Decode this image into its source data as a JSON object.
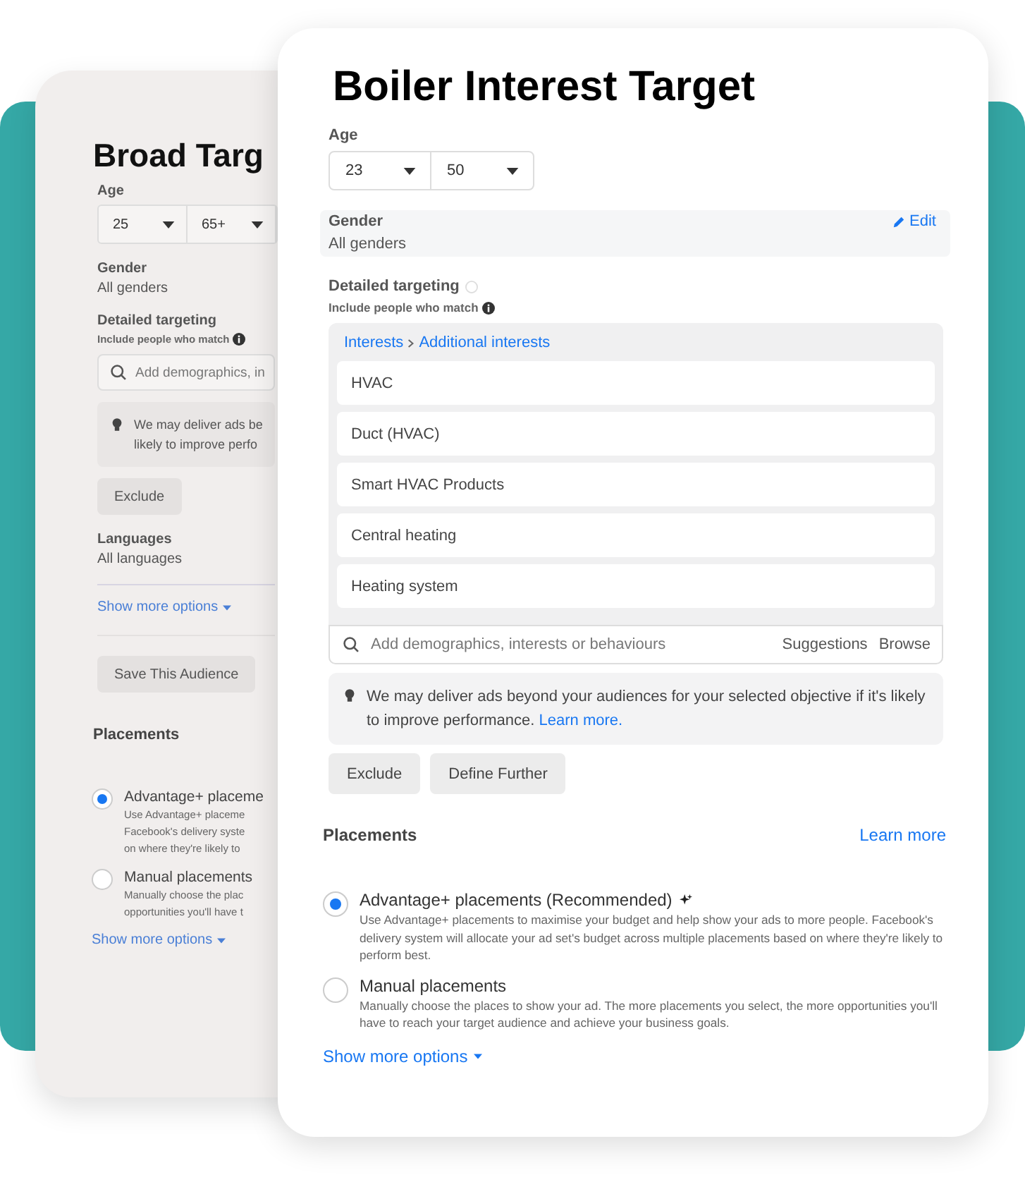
{
  "back_card": {
    "title": "Broad Targ",
    "age": {
      "label": "Age",
      "min": "25",
      "max": "65+"
    },
    "gender": {
      "label": "Gender",
      "value": "All genders"
    },
    "detailed_targeting": {
      "label": "Detailed targeting",
      "hint": "Include people who match",
      "search": {
        "placeholder": "Add demographics, in"
      },
      "note_lines": [
        "We may deliver ads be",
        "likely to improve perfo"
      ],
      "buttons": [
        "Exclude"
      ]
    },
    "languages": {
      "label": "Languages",
      "value": "All languages"
    },
    "show_more": "Show more options",
    "save_button": "Save This Audience",
    "placements": {
      "title": "Placements",
      "options": [
        {
          "label": "Advantage+ placeme",
          "selected": true,
          "description_lines": [
            "Use Advantage+ placeme",
            "Facebook's delivery syste",
            "on where they're likely to"
          ]
        },
        {
          "label": "Manual placements",
          "selected": false,
          "description_lines": [
            "Manually choose the plac",
            "opportunities you'll have t"
          ]
        }
      ],
      "show_more": "Show more options"
    }
  },
  "front_card": {
    "title": "Boiler Interest Target",
    "age": {
      "label": "Age",
      "min": "23",
      "max": "50"
    },
    "gender": {
      "label": "Gender",
      "value": "All genders",
      "edit": "Edit"
    },
    "detailed_targeting": {
      "label": "Detailed targeting",
      "hint": "Include people who match",
      "breadcrumb": [
        "Interests",
        "Additional interests"
      ],
      "interests": [
        "HVAC",
        "Duct (HVAC)",
        "Smart HVAC Products",
        "Central heating",
        "Heating system"
      ],
      "search": {
        "placeholder": "Add demographics, interests or behaviours",
        "actions": [
          "Suggestions",
          "Browse"
        ]
      },
      "note": {
        "text": "We may deliver ads beyond your audiences for your selected objective if it's likely to improve performance.",
        "link": "Learn more."
      },
      "buttons": [
        "Exclude",
        "Define Further"
      ]
    },
    "placements": {
      "title": "Placements",
      "link": "Learn more",
      "options": [
        {
          "label": "Advantage+ placements (Recommended)",
          "recommended": true,
          "selected": true,
          "description": "Use Advantage+ placements to maximise your budget and help show your ads to more people. Facebook's delivery system will allocate your ad set's budget across multiple placements based on where they're likely to perform best."
        },
        {
          "label": "Manual placements",
          "recommended": false,
          "selected": false,
          "description": "Manually choose the places to show your ad. The more placements you select, the more opportunities you'll have to reach your target audience and achieve your business goals."
        }
      ],
      "show_more": "Show more options"
    }
  }
}
